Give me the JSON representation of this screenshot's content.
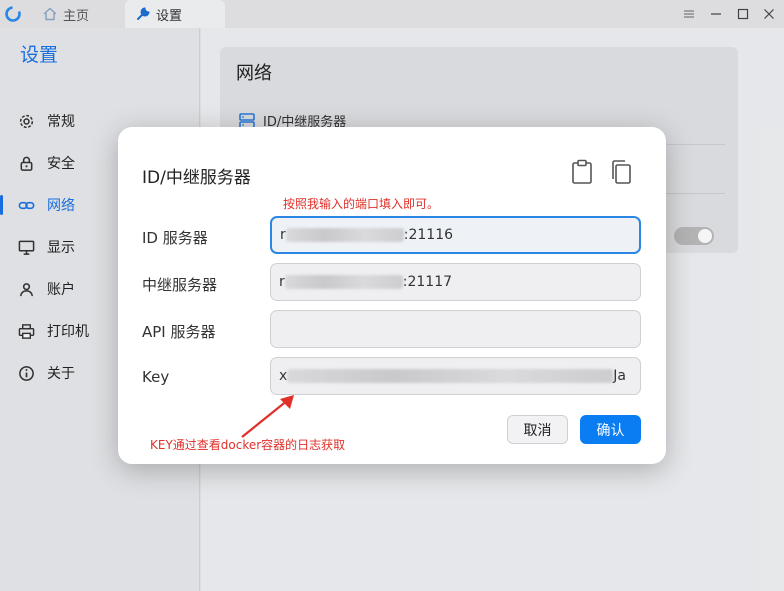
{
  "titlebar": {
    "tabs": [
      {
        "label": "主页",
        "icon": "home-icon"
      },
      {
        "label": "设置",
        "icon": "wrench-icon"
      }
    ],
    "controls": [
      "menu-icon",
      "minimize-icon",
      "maximize-icon",
      "close-icon"
    ]
  },
  "sidebar": {
    "title": "设置",
    "items": [
      {
        "label": "常规",
        "icon": "gear-icon"
      },
      {
        "label": "安全",
        "icon": "lock-icon"
      },
      {
        "label": "网络",
        "icon": "link-icon",
        "active": true
      },
      {
        "label": "显示",
        "icon": "monitor-icon"
      },
      {
        "label": "账户",
        "icon": "user-icon"
      },
      {
        "label": "打印机",
        "icon": "printer-icon"
      },
      {
        "label": "关于",
        "icon": "info-icon"
      }
    ]
  },
  "main": {
    "card_title": "网络",
    "server_row": "ID/中继服务器"
  },
  "dialog": {
    "title": "ID/中继服务器",
    "fields": [
      {
        "label": "ID 服务器",
        "value_prefix": "r",
        "value_suffix": ":21116"
      },
      {
        "label": "中继服务器",
        "value_prefix": "r",
        "value_suffix": ":21117"
      },
      {
        "label": "API 服务器",
        "value_prefix": "",
        "value_suffix": ""
      },
      {
        "label": "Key",
        "value_prefix": "x",
        "value_suffix": "Ja"
      }
    ],
    "cancel_label": "取消",
    "ok_label": "确认"
  },
  "annotations": {
    "top": "按照我输入的端口填入即可。",
    "bottom": "KEY通过查看docker容器的日志获取",
    "color": "#e0302a"
  },
  "colors": {
    "accent": "#1a73e8",
    "primary_button": "#0a7df2"
  }
}
